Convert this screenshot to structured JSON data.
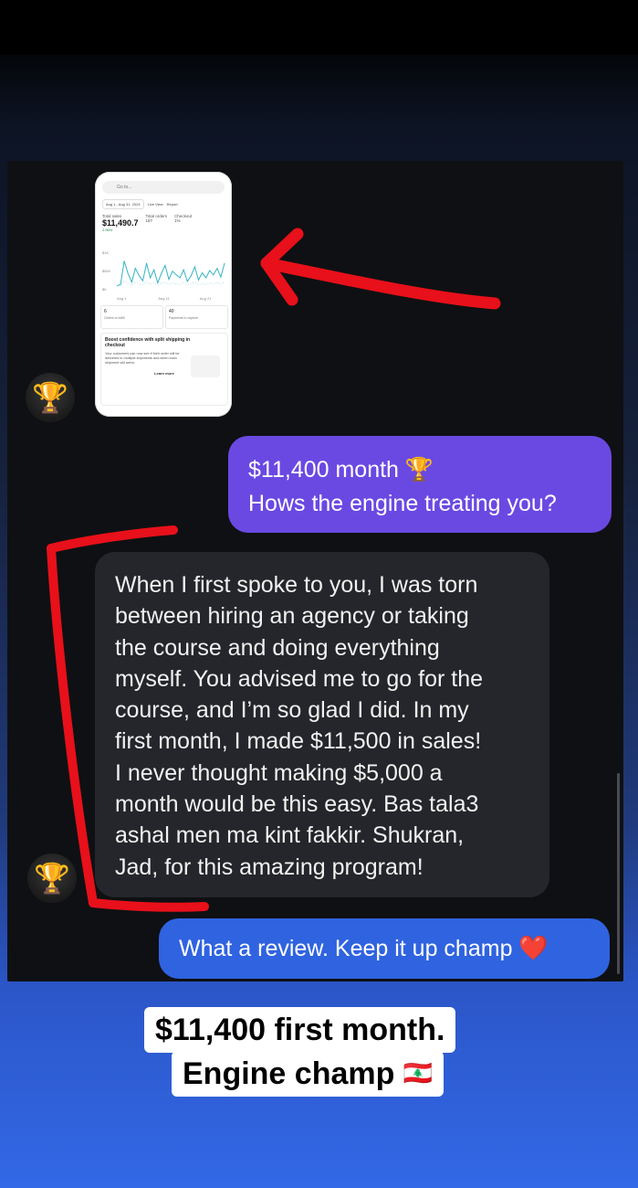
{
  "screenshot": {
    "search_placeholder": "Go to...",
    "date_filter": "Aug 1 - Aug 31, 2024",
    "live_view": "Live View",
    "report": "Report",
    "total_sales_label": "Total sales",
    "total_sales_value": "$11,490.7",
    "total_sales_delta": "2.96%",
    "total_orders_label": "Total orders",
    "total_orders_value": "187",
    "checkout_label": "Checkout",
    "checkout_value": "1%",
    "y_ticks": [
      "$1K",
      "$500",
      "$0"
    ],
    "x_ticks": [
      "Aug 1",
      "Aug 11",
      "Aug 21"
    ],
    "orders_count": "6",
    "orders_label": "Orders to fulfill",
    "payments_count": "40",
    "payments_label": "Payments to capture",
    "promo_title": "Boost confidence with split shipping in checkout",
    "promo_body": "Your customers can now see if their order will be delivered in multiple shipments and when each shipment will arrive.",
    "promo_link": "Learn more"
  },
  "messages": {
    "outgoing_1": {
      "line1": "$11,400 month",
      "line1_emoji": "🏆",
      "line2": "Hows the engine treating you?"
    },
    "incoming_1": {
      "lines": [
        "When I first spoke to you, I was torn",
        "between hiring an agency or taking",
        "the course and doing everything",
        "myself. You advised me to go for the",
        "course, and I’m so glad I did. In my",
        "first month, I made $11,500 in sales!",
        "I never thought making $5,000 a",
        "month would be this easy. Bas tala3",
        "ashal men ma kint fakkir. Shukran,",
        "Jad, for this amazing program!"
      ]
    },
    "outgoing_2": {
      "text": "What a review. Keep it up champ",
      "emoji": "❤️"
    }
  },
  "avatars": {
    "icon": "trophy-icon",
    "glyph": "🏆"
  },
  "caption": {
    "line1": "$11,400 first month.",
    "line2": "Engine champ",
    "flag": "🇱🇧"
  },
  "colors": {
    "outgoing_purple": "#6a49e2",
    "outgoing_blue": "#2f63e0",
    "incoming_gray": "#25262b",
    "annotation_red": "#e8101a"
  },
  "chart_data": {
    "type": "line",
    "title": "",
    "xlabel": "",
    "ylabel": "",
    "categories": [
      "Aug 1",
      "Aug 11",
      "Aug 21"
    ],
    "ylim": [
      0,
      1000
    ],
    "series": [
      {
        "values": [
          80,
          120,
          760,
          420,
          180,
          560,
          360,
          220,
          700,
          300,
          520,
          160,
          420,
          640,
          260,
          480,
          380,
          300,
          520,
          200,
          360,
          600,
          240,
          440,
          300,
          500,
          380,
          560,
          320,
          700
        ]
      }
    ]
  }
}
